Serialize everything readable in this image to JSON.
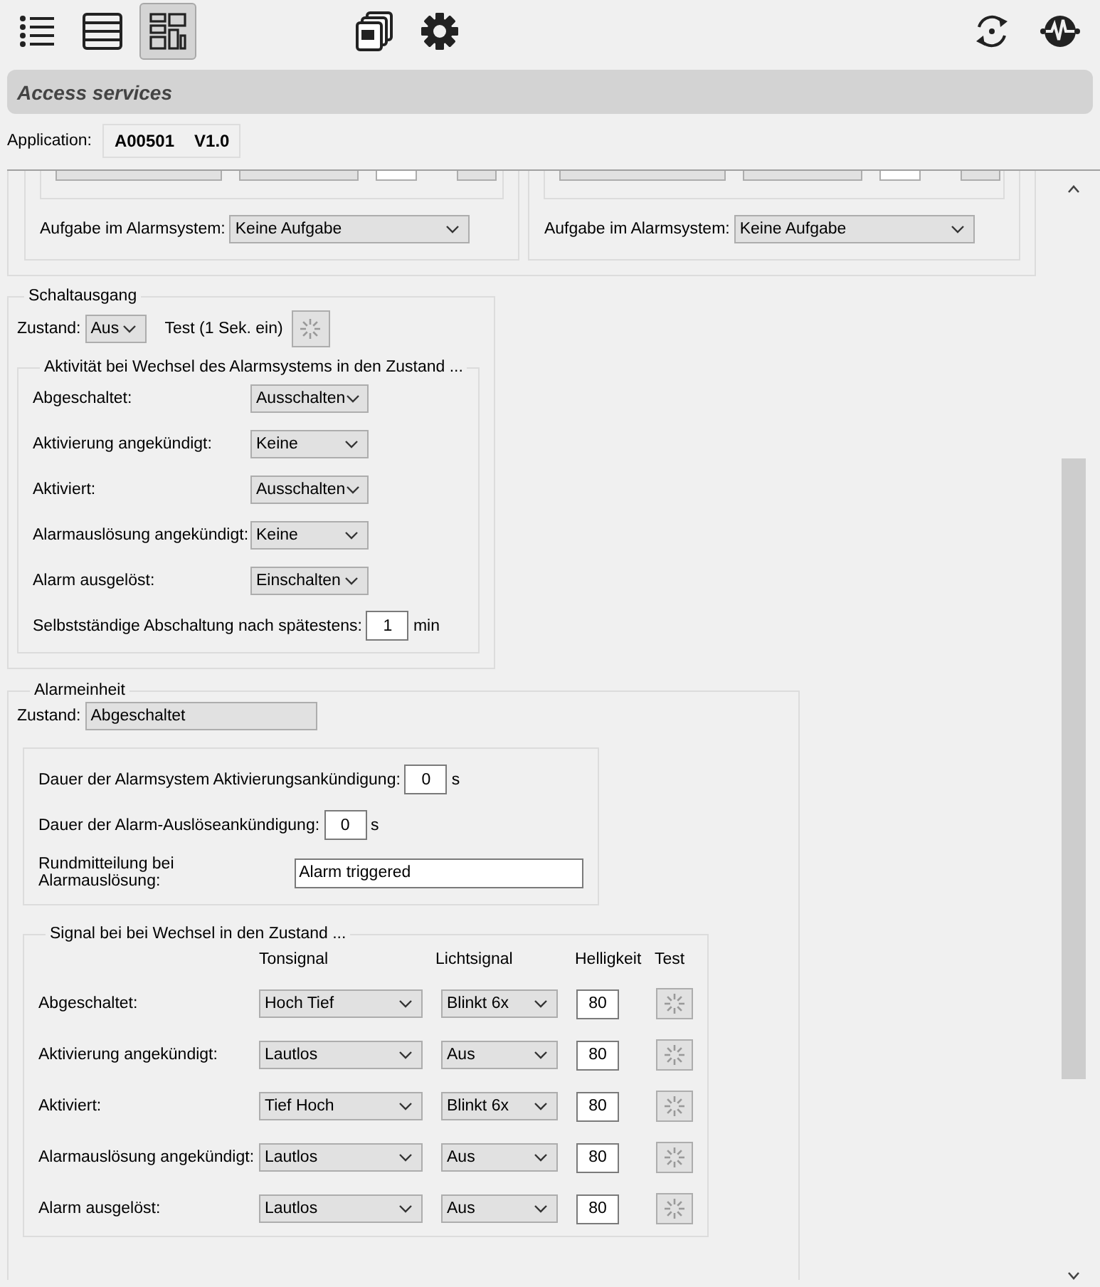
{
  "toolbar": {
    "view_buttons": [
      {
        "selected": false
      },
      {
        "selected": false
      },
      {
        "selected": true
      }
    ]
  },
  "header": {
    "title": "Access services"
  },
  "application": {
    "label": "Application:",
    "id": "A00501",
    "version": "V1.0"
  },
  "upper_section": {
    "columns": [
      {
        "task_label": "Aufgabe im Alarmsystem:",
        "task_value": "Keine Aufgabe"
      },
      {
        "task_label": "Aufgabe im Alarmsystem:",
        "task_value": "Keine Aufgabe"
      }
    ]
  },
  "switch_output": {
    "title": "Schaltausgang",
    "state_label": "Zustand:",
    "state_value": "Aus",
    "test_label": "Test (1 Sek. ein)",
    "activity": {
      "title": "Aktivität bei Wechsel des Alarmsystems in den Zustand ...",
      "rows": [
        {
          "label": "Abgeschaltet:",
          "value": "Ausschalten"
        },
        {
          "label": "Aktivierung angekündigt:",
          "value": "Keine"
        },
        {
          "label": "Aktiviert:",
          "value": "Ausschalten"
        },
        {
          "label": "Alarmauslösung angekündigt:",
          "value": "Keine"
        },
        {
          "label": "Alarm ausgelöst:",
          "value": "Einschalten"
        }
      ],
      "auto_off": {
        "label": "Selbstständige Abschaltung nach spätestens:",
        "value": "1",
        "unit": "min"
      }
    }
  },
  "alarm_unit": {
    "title": "Alarmeinheit",
    "state_label": "Zustand:",
    "state_value": "Abgeschaltet",
    "durations": [
      {
        "label": "Dauer der Alarmsystem Aktivierungsankündigung:",
        "value": "0",
        "unit": "s"
      },
      {
        "label": "Dauer der Alarm-Auslöseankündigung:",
        "value": "0",
        "unit": "s"
      }
    ],
    "broadcast": {
      "label": "Rundmitteilung bei Alarmauslösung:",
      "value": "Alarm triggered"
    },
    "signal": {
      "title": "Signal bei bei Wechsel in den Zustand ...",
      "columns": [
        "Tonsignal",
        "Lichtsignal",
        "Helligkeit",
        "Test"
      ],
      "rows": [
        {
          "label": "Abgeschaltet:",
          "tone": "Hoch Tief",
          "light": "Blinkt 6x",
          "brightness": "80"
        },
        {
          "label": "Aktivierung angekündigt:",
          "tone": "Lautlos",
          "light": "Aus",
          "brightness": "80"
        },
        {
          "label": "Aktiviert:",
          "tone": "Tief Hoch",
          "light": "Blinkt 6x",
          "brightness": "80"
        },
        {
          "label": "Alarmauslösung angekündigt:",
          "tone": "Lautlos",
          "light": "Aus",
          "brightness": "80"
        },
        {
          "label": "Alarm ausgelöst:",
          "tone": "Lautlos",
          "light": "Aus",
          "brightness": "80"
        }
      ]
    }
  }
}
